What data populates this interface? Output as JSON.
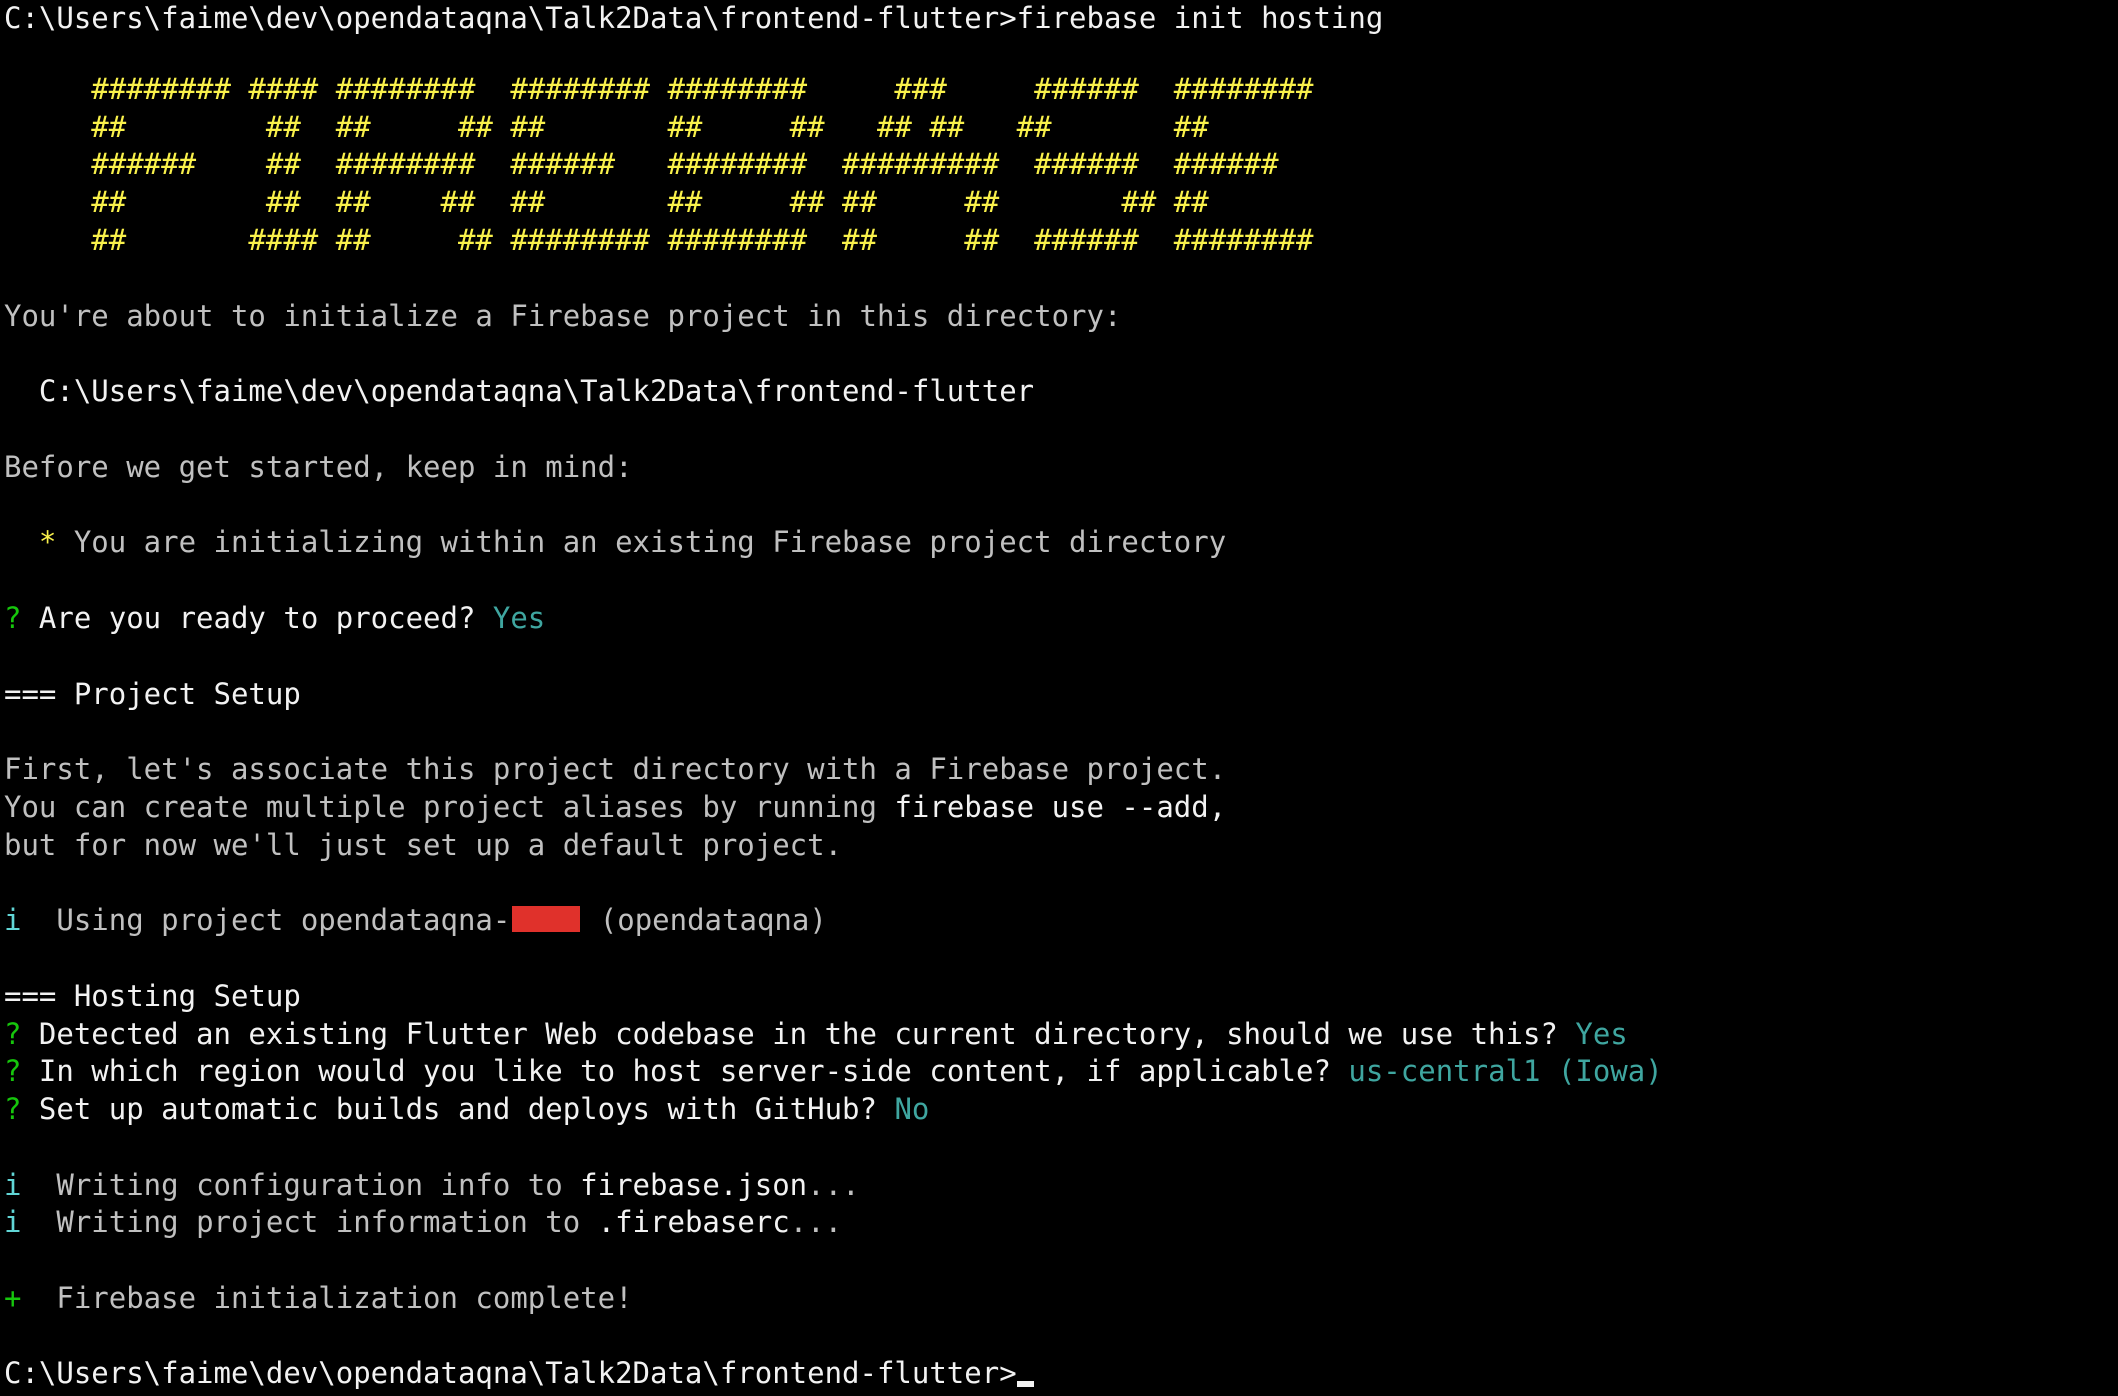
{
  "colors": {
    "background": "#000000",
    "text": "#c0c0c0",
    "bright_text": "#f2f2f2",
    "ascii_banner": "#f9f14b",
    "answer": "#3fa6a0",
    "info_marker": "#61d6d6",
    "success_marker": "#16c60c",
    "redaction": "#e0312b"
  },
  "prompt": {
    "path": "C:\\Users\\faime\\dev\\opendataqna\\Talk2Data\\frontend-flutter>",
    "command": "firebase init hosting"
  },
  "banner": [
    "     ######## #### ########  ######## ########     ###     ######  ########",
    "     ##        ##  ##     ## ##       ##     ##   ## ##   ##       ##",
    "     ######    ##  ########  ######   ########  #########  ######  ######",
    "     ##        ##  ##    ##  ##       ##     ## ##     ##       ## ##",
    "     ##       #### ##     ## ######## ########  ##     ##  ######  ########"
  ],
  "intro": {
    "about": "You're about to initialize a Firebase project in this directory:",
    "directory": "  C:\\Users\\faime\\dev\\opendataqna\\Talk2Data\\frontend-flutter",
    "keep_in_mind": "Before we get started, keep in mind:",
    "bullet_marker": "  * ",
    "bullet_text": "You are initializing within an existing Firebase project directory"
  },
  "ready": {
    "marker": "? ",
    "question": "Are you ready to proceed? ",
    "answer": "Yes"
  },
  "project_setup": {
    "heading": "=== Project Setup",
    "line1": "First, let's associate this project directory with a Firebase project.",
    "line2_prefix": "You can create multiple project aliases by running ",
    "line2_command": "firebase use --add",
    "line2_suffix": ",",
    "line3": "but for now we'll just set up a default project.",
    "using_marker": "i",
    "using_prefix": "  Using project opendataqna-",
    "using_suffix": " (opendataqna)"
  },
  "hosting_setup": {
    "heading": "=== Hosting Setup",
    "questions": [
      {
        "marker": "? ",
        "question": "Detected an existing Flutter Web codebase in the current directory, should we use this? ",
        "answer": "Yes"
      },
      {
        "marker": "? ",
        "question": "In which region would you like to host server-side content, if applicable? ",
        "answer": "us-central1 (Iowa)"
      },
      {
        "marker": "? ",
        "question": "Set up automatic builds and deploys with GitHub? ",
        "answer": "No"
      }
    ]
  },
  "writing": [
    {
      "marker": "i",
      "prefix": "  Writing configuration info to ",
      "file": "firebase.json",
      "suffix": "..."
    },
    {
      "marker": "i",
      "prefix": "  Writing project information to ",
      "file": ".firebaserc",
      "suffix": "..."
    }
  ],
  "complete": {
    "marker": "+",
    "text": "  Firebase initialization complete!"
  },
  "final_prompt": {
    "path": "C:\\Users\\faime\\dev\\opendataqna\\Talk2Data\\frontend-flutter>"
  }
}
